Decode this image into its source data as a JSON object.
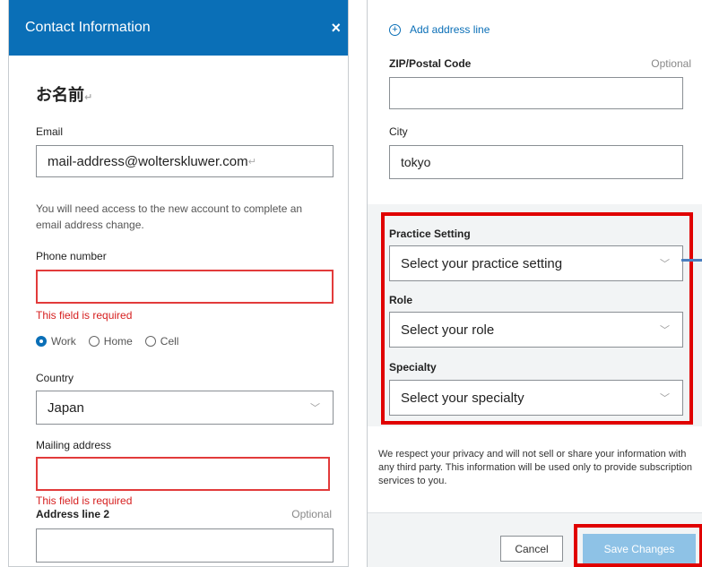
{
  "left": {
    "header_title": "Contact Information",
    "close_glyph": "×",
    "name_title": "お名前",
    "email_label": "Email",
    "email_value": "mail-address@wolterskluwer.com",
    "email_note": "You will need access to the new account to complete an email address change.",
    "phone_label": "Phone number",
    "phone_value": "",
    "phone_error": "This field is required",
    "phone_types": [
      {
        "label": "Work",
        "selected": true
      },
      {
        "label": "Home",
        "selected": false
      },
      {
        "label": "Cell",
        "selected": false
      }
    ],
    "country_label": "Country",
    "country_value": "Japan",
    "mailing_label": "Mailing address",
    "mailing_value": "",
    "mailing_error": "This field is required",
    "address2_label": "Address line 2",
    "address2_optional": "Optional",
    "address2_value": ""
  },
  "right": {
    "add_address_line": "Add address line",
    "zip_label": "ZIP/Postal Code",
    "zip_optional": "Optional",
    "zip_value": "",
    "city_label": "City",
    "city_value": "tokyo",
    "practice_label": "Practice Setting",
    "practice_placeholder": "Select your practice setting",
    "role_label": "Role",
    "role_placeholder": "Select your role",
    "specialty_label": "Specialty",
    "specialty_placeholder": "Select your specialty",
    "privacy_note": "We respect your privacy and will not sell or share your information with any third party. This information will be used only to provide subscription services to you.",
    "cancel_label": "Cancel",
    "save_label": "Save Changes"
  },
  "colors": {
    "brand_blue": "#0a6fb7",
    "error_red": "#d62020",
    "highlight_red": "#e00000",
    "save_disabled": "#8ec2e6"
  },
  "icons": {
    "plus": "plus-circle-icon",
    "chevron": "chevron-down-icon",
    "close": "close-icon",
    "return_mark": "return-mark-icon"
  }
}
